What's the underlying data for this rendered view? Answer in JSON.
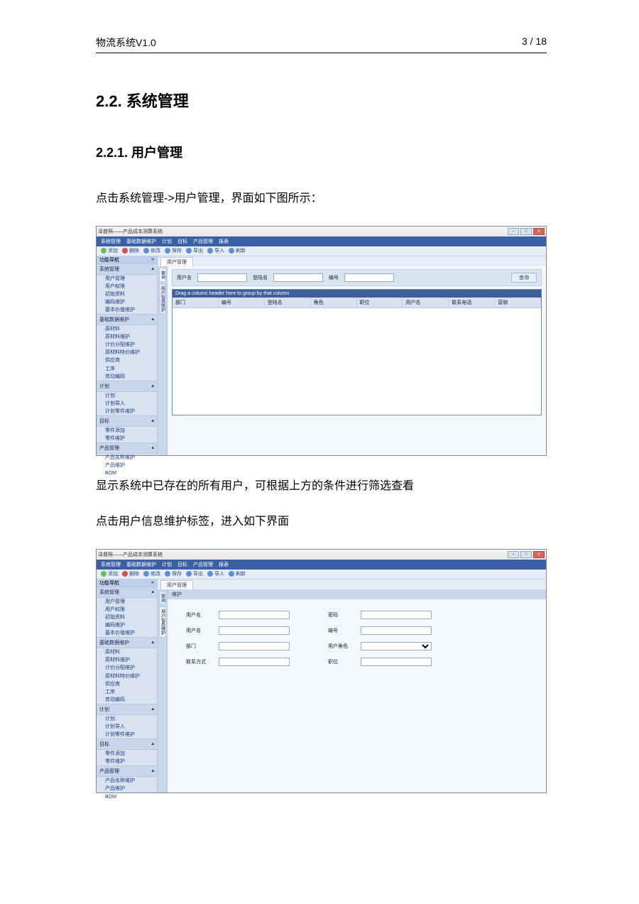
{
  "header": {
    "title": "物流系统V1.0",
    "page": "3 / 18"
  },
  "section": {
    "num_title": "2.2.  系统管理"
  },
  "subsection": {
    "num_title": "2.2.1. 用户管理"
  },
  "para1": "点击系统管理->用户管理，界面如下图所示：",
  "para2": "显示系统中已存在的所有用户，可根据上方的条件进行筛选查看",
  "para3": "点击用户信息维护标签，进入如下界面",
  "app": {
    "wintitle_prefix": "泽普照——",
    "wintitle": "产品成本测算系统",
    "menus": [
      "系统管理",
      "基础数据维护",
      "计划",
      "目标",
      "产品管理",
      "报表"
    ],
    "toolbar": [
      {
        "icon": "green",
        "label": "添加"
      },
      {
        "icon": "red",
        "label": "删除"
      },
      {
        "icon": "blue",
        "label": "修改"
      },
      {
        "icon": "blue",
        "label": "保存"
      },
      {
        "icon": "blue",
        "label": "导出"
      },
      {
        "icon": "blue",
        "label": "导入"
      },
      {
        "icon": "blue",
        "label": "刷新"
      }
    ],
    "side_header": "功能导航",
    "nav": [
      {
        "title": "系统管理",
        "items": [
          "用户管理",
          "用户权限",
          "初始资料",
          "编码维护",
          "基本价值维护"
        ]
      },
      {
        "title": "基础数据维护",
        "items": [
          "原材料",
          "原材料维护",
          "计价分配维护",
          "原材料特价维护",
          "供应商",
          "工序",
          "劳动编码"
        ]
      },
      {
        "title": "计划",
        "items": [
          "计划",
          "计划导入",
          "计划零件维护"
        ]
      },
      {
        "title": "目标",
        "items": [
          "零件添加",
          "零件维护"
        ]
      },
      {
        "title": "产品管理",
        "items": [
          "产品名称维护",
          "产品维护",
          "BOM"
        ]
      }
    ],
    "tab": "用户管理",
    "vtabs": [
      "查询",
      "用户信息维护"
    ],
    "filter": {
      "user": "用户名",
      "login": "登陆名",
      "code": "编号",
      "search": "查询"
    },
    "grid": {
      "group_hint": "Drag a column header here to group by that column",
      "cols": [
        "部门",
        "编号",
        "登陆名",
        "角色",
        "职位",
        "用户名",
        "联系电话",
        "营销"
      ]
    },
    "form_title": "维护",
    "form": {
      "user": "用户名",
      "pwd": "密码",
      "login": "用户名",
      "code": "编号",
      "dept": "部门",
      "role": "用户角色",
      "contact": "联系方式",
      "pos": "职位"
    }
  }
}
